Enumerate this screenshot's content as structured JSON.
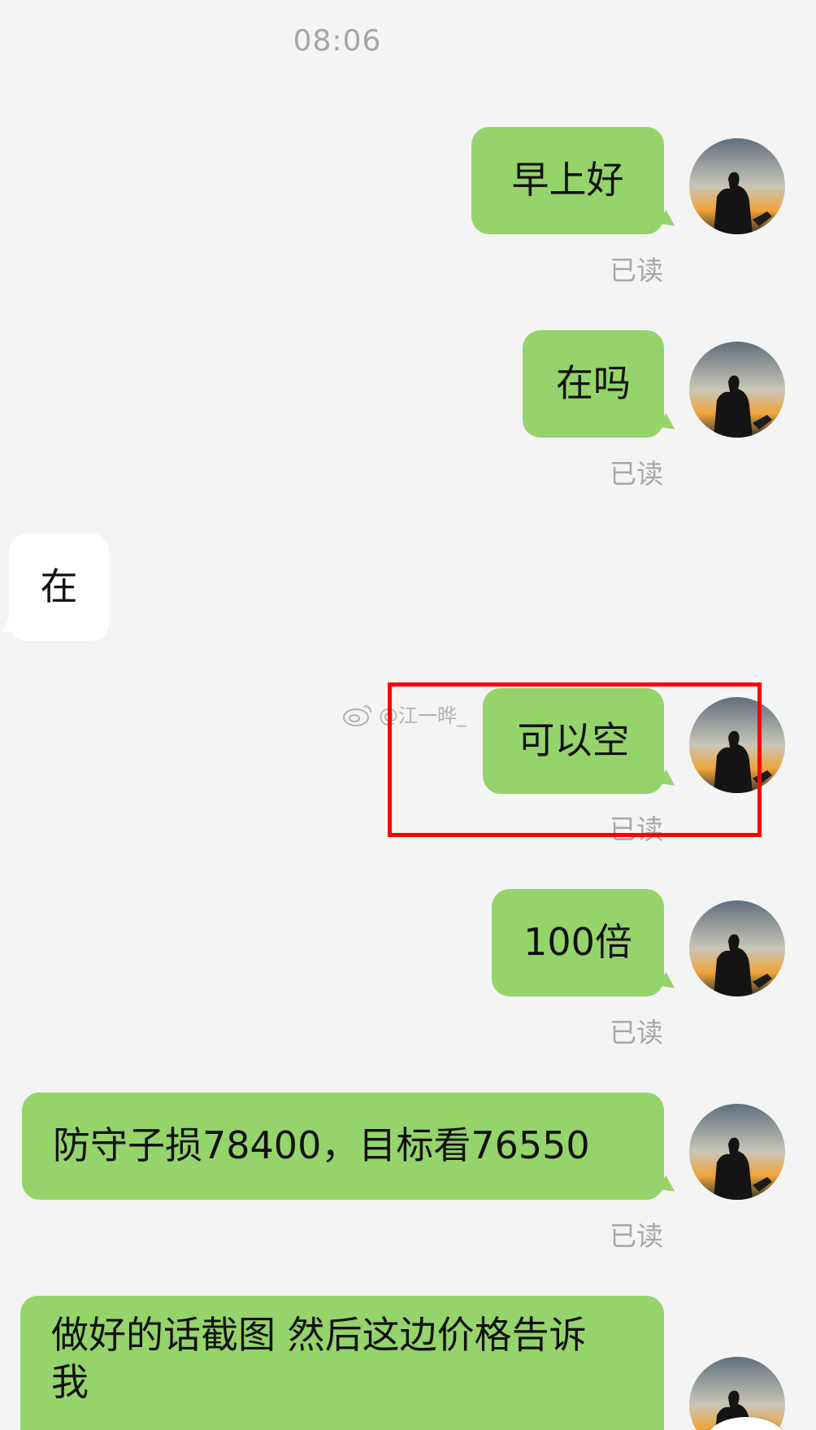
{
  "timestamp": "08:06",
  "read_label": "已读",
  "watermark": "@江一晔_",
  "colors": {
    "background": "#f4f4f4",
    "outgoing_bubble": "#95d46b",
    "incoming_bubble": "#ffffff",
    "highlight_box": "#ff0000",
    "meta_text": "#a8a8a8"
  },
  "messages": [
    {
      "direction": "outgoing",
      "text": "早上好",
      "status": "已读"
    },
    {
      "direction": "outgoing",
      "text": "在吗",
      "status": "已读"
    },
    {
      "direction": "incoming",
      "text": "在"
    },
    {
      "direction": "outgoing",
      "text": "可以空",
      "status": "已读",
      "highlighted": true
    },
    {
      "direction": "outgoing",
      "text": "100倍",
      "status": "已读"
    },
    {
      "direction": "outgoing",
      "text": "防守子损78400，目标看76550",
      "status": "已读"
    },
    {
      "direction": "outgoing",
      "text": "做好的话截图 然后这边价格告诉我"
    }
  ]
}
